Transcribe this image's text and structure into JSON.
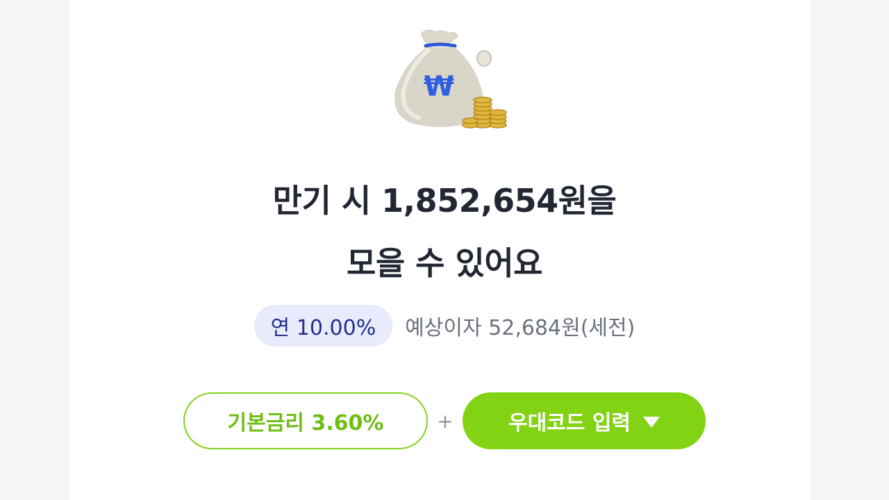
{
  "hero": {
    "icon": "money-bag-won-icon",
    "headline_line1": "만기 시 1,852,654원을",
    "headline_line2": "모을 수 있어요"
  },
  "rate": {
    "annual_rate_label": "연 10.00%",
    "expected_interest": "예상이자 52,684원(세전)"
  },
  "actions": {
    "base_rate_label": "기본금리 3.60%",
    "plus_sign": "+",
    "promo_code_label": "우대코드 입력"
  },
  "colors": {
    "accent_green": "#82d313",
    "rate_pill_bg": "#e8ebfb",
    "rate_pill_text": "#25308f",
    "headline_text": "#222833"
  }
}
